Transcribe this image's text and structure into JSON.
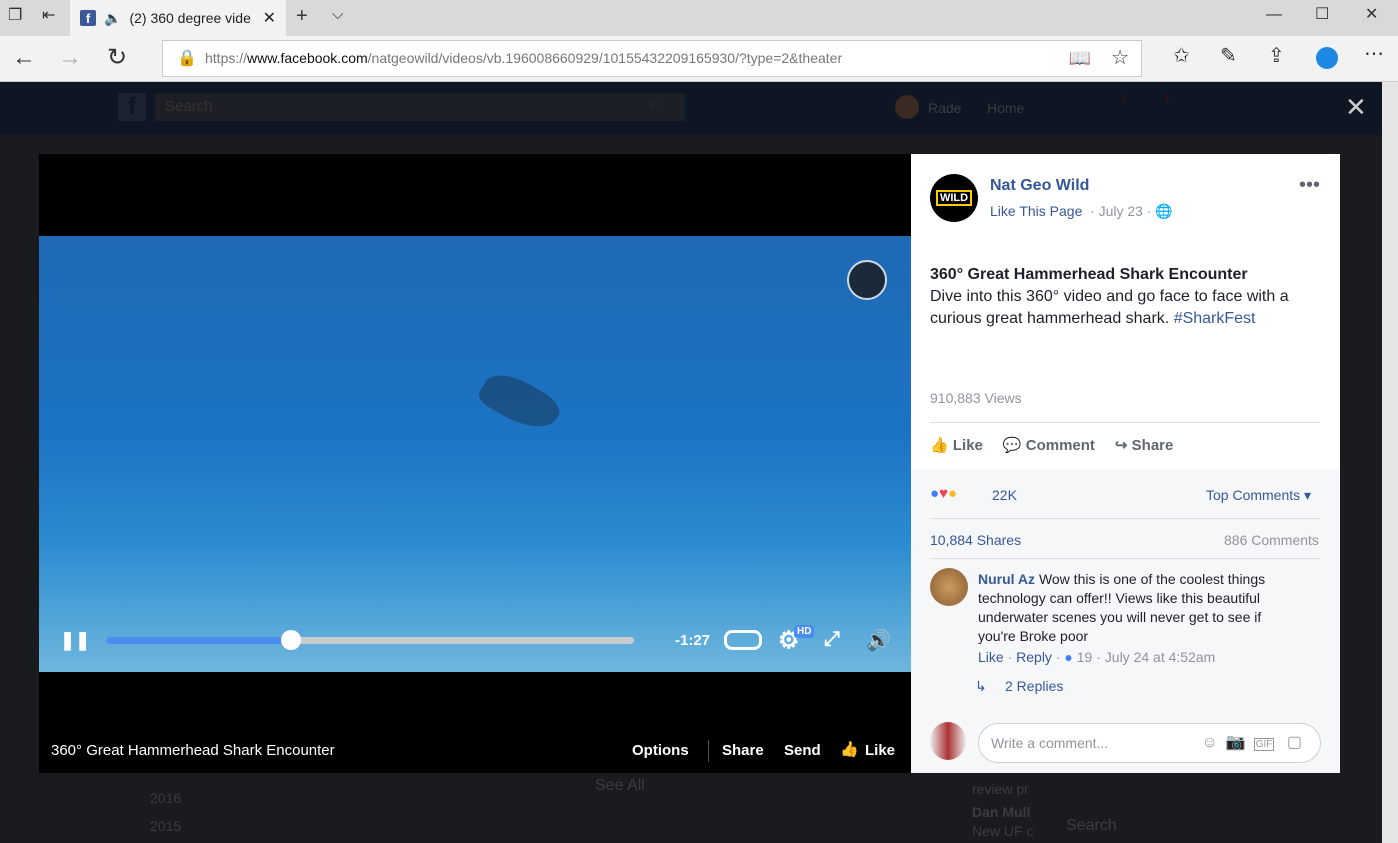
{
  "browser": {
    "tab_title": "(2) 360 degree vide",
    "url_prefix": "https://",
    "url_domain": "www.facebook.com",
    "url_path": "/natgeowild/videos/vb.196008660929/10155432209165930/?type=2&theater"
  },
  "fb_header": {
    "search_placeholder": "Search",
    "user": "Rade",
    "home": "Home",
    "badge1": "1",
    "badge2": "1"
  },
  "background": {
    "years": [
      "2016",
      "2015"
    ],
    "see_all": "See All",
    "snippets": [
      "review pr",
      "Dan Mull",
      "New UF c"
    ],
    "chat_search": "Search"
  },
  "video": {
    "time_remaining": "-1:27",
    "progress_percent": 35,
    "hd_badge": "HD",
    "title": "360° Great Hammerhead Shark Encounter",
    "options": "Options",
    "share": "Share",
    "send": "Send",
    "like": "Like"
  },
  "post": {
    "page_name": "Nat Geo Wild",
    "logo_text": "WILD",
    "like_page": "Like This Page",
    "date": "July 23",
    "title": "360° Great Hammerhead Shark Encounter",
    "body": "Dive into this 360° video and go face to face with a curious great hammerhead shark.",
    "hashtag": "#SharkFest",
    "views": "910,883 Views",
    "actions": {
      "like": "Like",
      "comment": "Comment",
      "share": "Share"
    },
    "reactions": "22K",
    "sort": "Top Comments",
    "shares": "10,884 Shares",
    "comments": "886 Comments"
  },
  "comment": {
    "author": "Nurul Az",
    "text": "Wow this is one of the coolest things technology can offer!! Views like this beautiful underwater scenes you will never get to see if you're Broke poor",
    "like": "Like",
    "reply": "Reply",
    "likes": "19",
    "time": "July 24 at 4:52am",
    "replies": "2 Replies"
  },
  "composer": {
    "placeholder": "Write a comment..."
  },
  "colors": {
    "fb_blue": "#365899",
    "accent": "#4080ff"
  }
}
